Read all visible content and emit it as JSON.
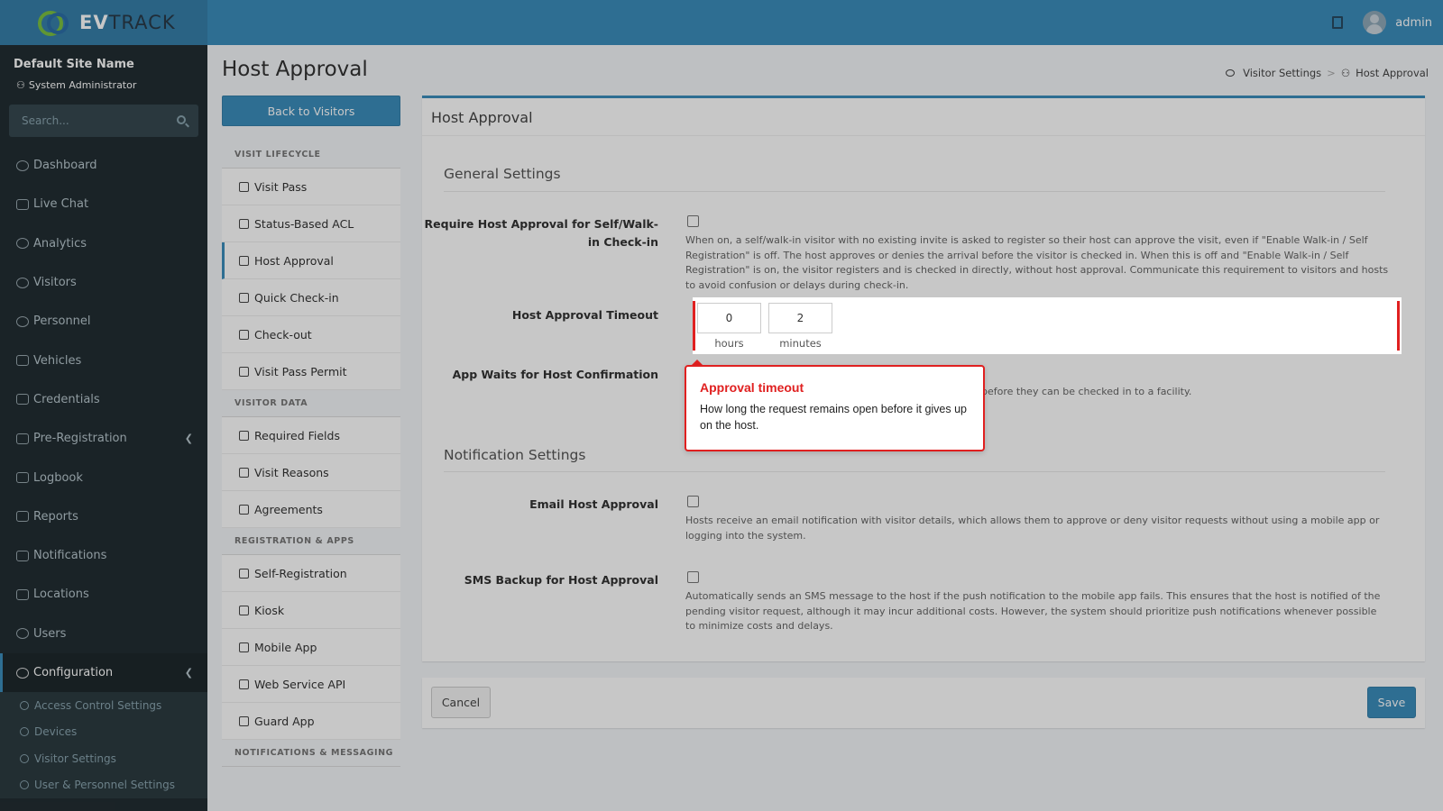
{
  "brand": {
    "logo_bold": "EV",
    "logo_rest": "TRACK"
  },
  "topbar": {
    "user_name": "admin"
  },
  "sidebar": {
    "site_name": "Default Site Name",
    "role": "System Administrator",
    "search_placeholder": "Search...",
    "items": [
      {
        "label": "Dashboard"
      },
      {
        "label": "Live Chat"
      },
      {
        "label": "Analytics"
      },
      {
        "label": "Visitors"
      },
      {
        "label": "Personnel"
      },
      {
        "label": "Vehicles"
      },
      {
        "label": "Credentials"
      },
      {
        "label": "Pre-Registration"
      },
      {
        "label": "Logbook"
      },
      {
        "label": "Reports"
      },
      {
        "label": "Notifications"
      },
      {
        "label": "Locations"
      },
      {
        "label": "Users"
      },
      {
        "label": "Configuration"
      }
    ],
    "sub_items": [
      {
        "label": "Access Control Settings"
      },
      {
        "label": "Devices"
      },
      {
        "label": "Visitor Settings"
      },
      {
        "label": "User & Personnel Settings"
      }
    ]
  },
  "page": {
    "title": "Host Approval",
    "back_button": "Back to Visitors",
    "breadcrumb": {
      "parent": "Visitor Settings",
      "current": "Host Approval"
    }
  },
  "settings_menu": {
    "visit_lifecycle_header": "VISIT LIFECYCLE",
    "visit_lifecycle": [
      "Visit Pass",
      "Status-Based ACL",
      "Host Approval",
      "Quick Check-in",
      "Check-out",
      "Visit Pass Permit"
    ],
    "visitor_data_header": "VISITOR DATA",
    "visitor_data": [
      "Required Fields",
      "Visit Reasons",
      "Agreements"
    ],
    "registration_header": "REGISTRATION & APPS",
    "registration": [
      "Self-Registration",
      "Kiosk",
      "Mobile App",
      "Web Service API",
      "Guard App"
    ],
    "notifications_header": "NOTIFICATIONS & MESSAGING"
  },
  "panel": {
    "title": "Host Approval",
    "general_title": "General Settings",
    "require_label": "Require Host Approval for Self/Walk-in Check-in",
    "require_help": "When on, a self/walk-in visitor with no existing invite is asked to register so their host can approve the visit, even if \"Enable Walk-in / Self Registration\" is off. The host approves or denies the arrival before the visitor is checked in. When this is off and \"Enable Walk-in / Self Registration\" is on, the visitor registers and is checked in directly, without host approval. Communicate this requirement to visitors and hosts to avoid confusion or delays during check-in.",
    "timeout_label": "Host Approval Timeout",
    "timeout_hours": "0",
    "timeout_minutes": "2",
    "hours_label": "hours",
    "minutes_label": "minutes",
    "app_waits_label": "App Waits for Host Confirmation",
    "app_waits_help_visible": "before they can be checked in to a facility.",
    "notification_title": "Notification Settings",
    "email_label": "Email Host Approval",
    "email_help": "Hosts receive an email notification with visitor details, which allows them to approve or deny visitor requests without using a mobile app or logging into the system.",
    "sms_label": "SMS Backup for Host Approval",
    "sms_help": "Automatically sends an SMS message to the host if the push notification to the mobile app fails. This ensures that the host is notified of the pending visitor request, although it may incur additional costs. However, the system should prioritize push notifications whenever possible to minimize costs and delays."
  },
  "callout": {
    "title": "Approval timeout",
    "body": "How long the request remains open before it gives up on the host."
  },
  "footer": {
    "cancel": "Cancel",
    "save": "Save"
  },
  "colors": {
    "primary": "#3c8dbc",
    "sidebar": "#222d32",
    "highlight": "#e02020"
  }
}
